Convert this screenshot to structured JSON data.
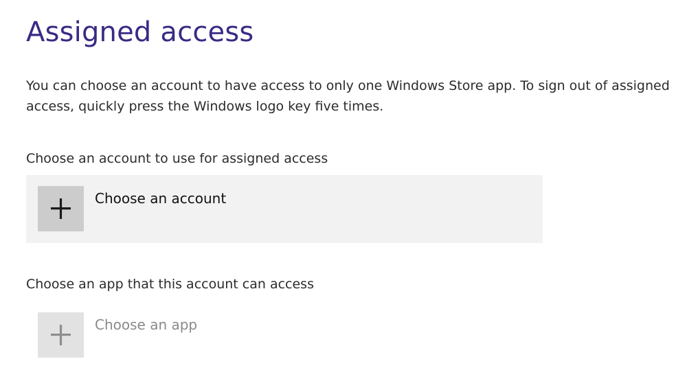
{
  "page": {
    "title": "Assigned access",
    "description": "You can choose an account to have access to only one Windows Store app. To sign out of assigned access, quickly press the Windows logo key five times."
  },
  "account_section": {
    "label": "Choose an account to use for assigned access",
    "button_label": "Choose an account",
    "icon": "plus-icon",
    "enabled": true
  },
  "app_section": {
    "label": "Choose an app that this account can access",
    "button_label": "Choose an app",
    "icon": "plus-icon",
    "enabled": false
  },
  "colors": {
    "title": "#3a2a85",
    "text": "#2b2b2b",
    "tile_background": "#f2f2f2",
    "icon_box_enabled": "#cccccc",
    "icon_box_disabled": "#e2e2e2",
    "disabled_text": "#8a8a8a"
  }
}
